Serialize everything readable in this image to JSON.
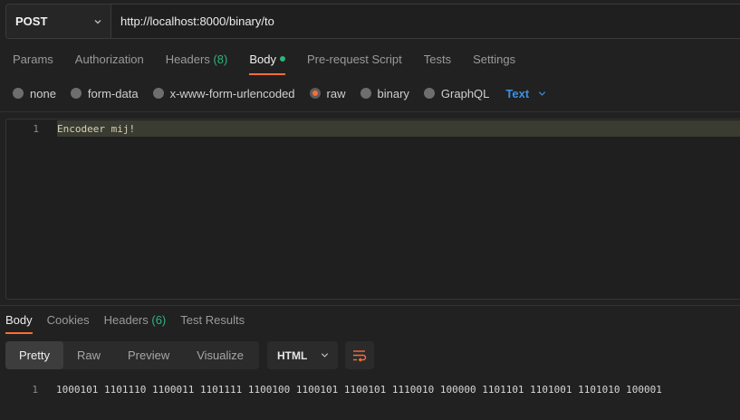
{
  "request": {
    "method": "POST",
    "url": "http://localhost:8000/binary/to"
  },
  "request_tabs": [
    {
      "label": "Params"
    },
    {
      "label": "Authorization"
    },
    {
      "label": "Headers",
      "count": "(8)"
    },
    {
      "label": "Body",
      "active": true
    },
    {
      "label": "Pre-request Script"
    },
    {
      "label": "Tests"
    },
    {
      "label": "Settings"
    }
  ],
  "body_types": [
    {
      "label": "none"
    },
    {
      "label": "form-data"
    },
    {
      "label": "x-www-form-urlencoded"
    },
    {
      "label": "raw",
      "selected": true
    },
    {
      "label": "binary"
    },
    {
      "label": "GraphQL"
    }
  ],
  "raw_format": "Text",
  "editor": {
    "line_number": "1",
    "content": "Encodeer mij!"
  },
  "response_tabs": [
    {
      "label": "Body",
      "active": true
    },
    {
      "label": "Cookies"
    },
    {
      "label": "Headers",
      "count": "(6)"
    },
    {
      "label": "Test Results"
    }
  ],
  "view_modes": [
    {
      "label": "Pretty",
      "active": true
    },
    {
      "label": "Raw"
    },
    {
      "label": "Preview"
    },
    {
      "label": "Visualize"
    }
  ],
  "response_language": "HTML",
  "response": {
    "line_number": "1",
    "content": "1000101 1101110 1100011 1101111 1100100 1100101 1100101 1110010 100000 1101101 1101001 1101010 100001"
  },
  "colors": {
    "accent": "#ff6c37",
    "green": "#2fb47c",
    "link_blue": "#3d8fe0"
  },
  "icons": {
    "method_chevron": "chevron-down-icon",
    "format_chevron": "chevron-down-icon",
    "wrap": "wrap-lines-icon"
  }
}
